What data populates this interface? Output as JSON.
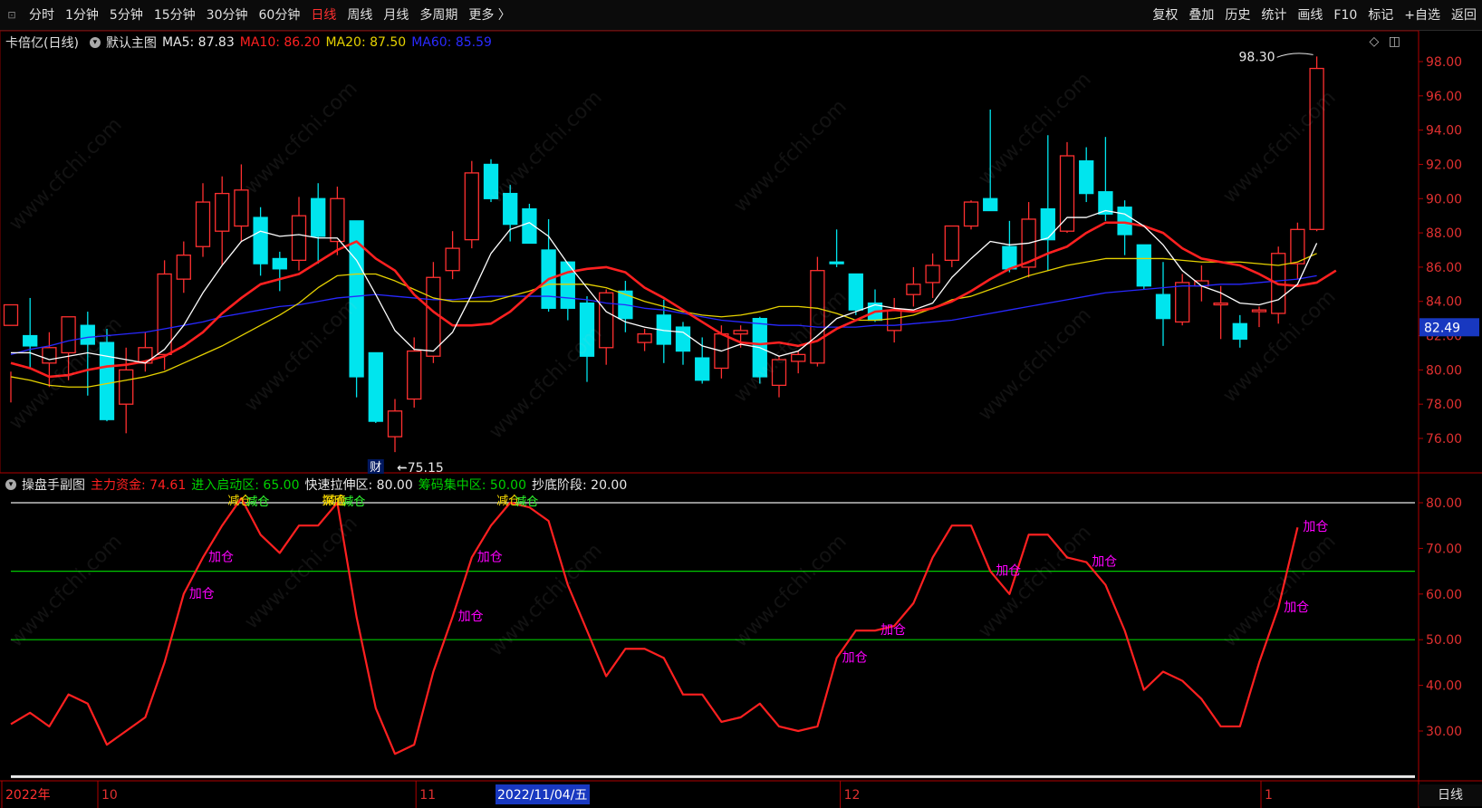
{
  "toolbar": {
    "left_items": [
      "分时",
      "1分钟",
      "5分钟",
      "15分钟",
      "30分钟",
      "60分钟",
      "日线",
      "周线",
      "月线",
      "多周期",
      "更多 〉"
    ],
    "active": "日线",
    "right_items": [
      "复权",
      "叠加",
      "历史",
      "统计",
      "画线",
      "F10",
      "标记",
      "+自选",
      "返回"
    ]
  },
  "main": {
    "stock": "卡倍亿(日线)",
    "indicator": "默认主图",
    "ma5": "MA5: 87.83",
    "ma10": "MA10: 86.20",
    "ma20": "MA20: 87.50",
    "ma60": "MA60: 85.59",
    "high_label": "98.30",
    "low_label": "75.15",
    "current_price": "82.49",
    "cai_label": "财",
    "y_ticks": [
      "98.00",
      "96.00",
      "94.00",
      "92.00",
      "90.00",
      "88.00",
      "86.00",
      "84.00",
      "82.00",
      "80.00",
      "78.00",
      "76.00"
    ]
  },
  "sub": {
    "name": "操盘手副图",
    "l1": "主力资金: 74.61",
    "l2": "进入启动区: 65.00",
    "l3": "快速拉伸区: 80.00",
    "l4": "筹码集中区: 50.00",
    "l5": "抄底阶段: 20.00",
    "y_ticks": [
      "80.00",
      "70.00",
      "60.00",
      "50.00",
      "40.00",
      "30.00"
    ],
    "signal": "加仓",
    "signal_top": "减仓",
    "signal_top2": "探底"
  },
  "xaxis": {
    "labels": [
      "2022年",
      "10",
      "11",
      "12",
      "1"
    ],
    "cursor_date": "2022/11/04/五",
    "period": "日线"
  },
  "watermark": "www.cfchi.com",
  "colors": {
    "up": "#ff3030",
    "down": "#00e5ee",
    "ma5": "#ffffff",
    "ma10": "#ff2020",
    "ma20": "#e6d200",
    "ma60": "#2828ff",
    "green": "#00c800",
    "magenta": "#ff00ff"
  },
  "chart_data": {
    "type": "candlestick",
    "ylim": [
      74.5,
      99.0
    ],
    "candles": [
      [
        82.6,
        83.8,
        79.9,
        78.1
      ],
      [
        82.0,
        81.4,
        84.2,
        80.1
      ],
      [
        80.4,
        81.3,
        82.2,
        79.0
      ],
      [
        81.0,
        83.1,
        83.1,
        79.4
      ],
      [
        82.6,
        81.5,
        83.4,
        78.5
      ],
      [
        81.6,
        77.1,
        82.4,
        77.0
      ],
      [
        78.0,
        80.0,
        81.3,
        76.3
      ],
      [
        80.4,
        81.3,
        82.2,
        79.9
      ],
      [
        80.9,
        85.6,
        86.4,
        80.0
      ],
      [
        85.3,
        86.7,
        87.5,
        84.5
      ],
      [
        87.2,
        89.8,
        90.9,
        86.6
      ],
      [
        88.1,
        90.3,
        91.3,
        86.1
      ],
      [
        88.4,
        90.5,
        92.0,
        87.5
      ],
      [
        88.9,
        86.2,
        89.5,
        85.5
      ],
      [
        86.5,
        85.9,
        86.9,
        84.6
      ],
      [
        86.4,
        89.0,
        90.1,
        85.8
      ],
      [
        90.0,
        87.8,
        90.9,
        86.2
      ],
      [
        87.5,
        90.0,
        90.7,
        86.7
      ],
      [
        88.7,
        79.6,
        88.7,
        78.4
      ],
      [
        81.0,
        77.0,
        81.0,
        76.9
      ],
      [
        76.1,
        77.6,
        78.3,
        75.2
      ],
      [
        78.3,
        81.1,
        81.9,
        77.8
      ],
      [
        80.8,
        85.4,
        86.3,
        80.4
      ],
      [
        85.8,
        87.1,
        88.1,
        85.3
      ],
      [
        87.6,
        91.5,
        92.2,
        87.1
      ],
      [
        92.0,
        90.0,
        92.3,
        89.8
      ],
      [
        90.3,
        88.5,
        90.8,
        87.5
      ],
      [
        89.4,
        87.4,
        89.7,
        87.4
      ],
      [
        87.0,
        83.6,
        88.8,
        83.4
      ],
      [
        86.3,
        83.6,
        86.3,
        82.9
      ],
      [
        83.9,
        80.8,
        84.3,
        79.3
      ],
      [
        81.3,
        84.5,
        84.7,
        80.3
      ],
      [
        84.6,
        83.0,
        85.2,
        82.2
      ],
      [
        81.6,
        82.1,
        82.4,
        81.1
      ],
      [
        83.2,
        81.5,
        84.1,
        80.4
      ],
      [
        82.5,
        81.1,
        82.8,
        80.3
      ],
      [
        80.7,
        79.4,
        81.9,
        79.2
      ],
      [
        80.1,
        82.1,
        82.6,
        79.5
      ],
      [
        82.1,
        82.3,
        82.6,
        81.3
      ],
      [
        83.0,
        79.6,
        83.1,
        79.2
      ],
      [
        79.1,
        80.6,
        80.8,
        78.4
      ],
      [
        80.5,
        80.9,
        81.1,
        79.8
      ],
      [
        80.4,
        85.8,
        86.6,
        80.2
      ],
      [
        86.3,
        86.2,
        88.2,
        86.0
      ],
      [
        85.6,
        83.5,
        85.4,
        83.2
      ],
      [
        83.9,
        82.9,
        84.7,
        82.8
      ],
      [
        82.3,
        83.5,
        84.2,
        81.6
      ],
      [
        84.4,
        85.0,
        86.0,
        83.7
      ],
      [
        85.1,
        86.1,
        86.8,
        84.2
      ],
      [
        86.4,
        88.4,
        88.4,
        86.0
      ],
      [
        88.4,
        89.8,
        89.9,
        88.2
      ],
      [
        90.0,
        89.3,
        95.2,
        89.3
      ],
      [
        87.2,
        85.9,
        88.7,
        85.7
      ],
      [
        86.0,
        88.8,
        89.8,
        85.4
      ],
      [
        89.4,
        87.6,
        93.7,
        85.8
      ],
      [
        88.1,
        92.5,
        93.3,
        88.0
      ],
      [
        92.2,
        90.3,
        93.0,
        89.8
      ],
      [
        90.4,
        89.1,
        93.6,
        88.7
      ],
      [
        89.5,
        87.9,
        89.9,
        86.7
      ],
      [
        87.3,
        84.9,
        87.3,
        84.7
      ],
      [
        84.4,
        83.0,
        86.3,
        81.4
      ],
      [
        82.8,
        85.1,
        85.6,
        82.6
      ],
      [
        84.9,
        85.2,
        86.1,
        84.0
      ],
      [
        83.8,
        83.9,
        84.9,
        81.8
      ],
      [
        82.7,
        81.8,
        83.2,
        81.3
      ],
      [
        83.4,
        83.5,
        83.7,
        82.5
      ],
      [
        83.3,
        86.8,
        87.2,
        82.7
      ],
      [
        86.2,
        88.2,
        88.6,
        85.3
      ],
      [
        88.2,
        97.6,
        98.3,
        88.1
      ]
    ],
    "ma5": [
      81.0,
      81.0,
      80.6,
      80.8,
      81.0,
      80.8,
      80.6,
      80.4,
      81.2,
      82.6,
      84.5,
      86.1,
      87.5,
      88.1,
      87.8,
      87.9,
      87.7,
      87.7,
      86.4,
      84.4,
      82.3,
      81.2,
      81.1,
      82.2,
      84.4,
      86.8,
      88.2,
      88.6,
      87.8,
      86.2,
      84.8,
      83.4,
      82.8,
      82.5,
      82.3,
      82.2,
      81.4,
      81.1,
      81.5,
      81.3,
      80.8,
      81.1,
      82.0,
      83.0,
      83.4,
      83.8,
      83.6,
      83.5,
      83.9,
      85.4,
      86.5,
      87.5,
      87.3,
      87.4,
      87.7,
      88.9,
      88.9,
      89.3,
      89.1,
      88.4,
      87.3,
      85.8,
      84.9,
      84.5,
      83.9,
      83.8,
      84.1,
      85.0,
      87.4
    ],
    "ma10": [
      80.4,
      80.1,
      79.6,
      79.7,
      80.0,
      80.2,
      80.3,
      80.5,
      80.8,
      81.4,
      82.2,
      83.3,
      84.2,
      85.0,
      85.3,
      85.6,
      86.3,
      87.0,
      87.5,
      86.5,
      85.8,
      84.4,
      83.4,
      82.6,
      82.6,
      82.7,
      83.4,
      84.4,
      85.3,
      85.7,
      85.9,
      86.0,
      85.7,
      84.8,
      84.2,
      83.5,
      82.8,
      82.1,
      81.6,
      81.5,
      81.6,
      81.4,
      81.7,
      82.4,
      82.9,
      83.4,
      83.5,
      83.4,
      83.6,
      84.0,
      84.6,
      85.3,
      85.9,
      86.3,
      86.8,
      87.2,
      88.0,
      88.6,
      88.6,
      88.4,
      88.0,
      87.1,
      86.5,
      86.3,
      86.1,
      85.6,
      85.0,
      84.9,
      85.1,
      85.8
    ],
    "ma20": [
      79.6,
      79.4,
      79.1,
      79.0,
      79.0,
      79.2,
      79.4,
      79.6,
      79.9,
      80.4,
      80.9,
      81.4,
      82.0,
      82.6,
      83.2,
      83.9,
      84.8,
      85.5,
      85.6,
      85.6,
      85.2,
      84.7,
      84.2,
      84.0,
      84.0,
      84.0,
      84.3,
      84.6,
      85.0,
      85.0,
      85.0,
      84.8,
      84.4,
      84.0,
      83.7,
      83.4,
      83.2,
      83.1,
      83.2,
      83.4,
      83.7,
      83.7,
      83.6,
      83.3,
      82.9,
      82.9,
      83.0,
      83.2,
      83.6,
      84.1,
      84.3,
      84.7,
      85.1,
      85.5,
      85.8,
      86.1,
      86.3,
      86.5,
      86.5,
      86.5,
      86.5,
      86.4,
      86.3,
      86.3,
      86.3,
      86.2,
      86.1,
      86.3,
      86.8
    ],
    "ma60": [
      80.9,
      81.2,
      81.4,
      81.7,
      81.9,
      82.0,
      82.1,
      82.2,
      82.4,
      82.6,
      82.8,
      83.1,
      83.3,
      83.5,
      83.7,
      83.8,
      84.0,
      84.2,
      84.3,
      84.4,
      84.3,
      84.2,
      84.1,
      84.1,
      84.2,
      84.3,
      84.3,
      84.3,
      84.3,
      84.2,
      84.1,
      83.9,
      83.8,
      83.6,
      83.5,
      83.3,
      83.1,
      82.9,
      82.8,
      82.7,
      82.6,
      82.6,
      82.5,
      82.5,
      82.5,
      82.6,
      82.6,
      82.7,
      82.8,
      82.9,
      83.1,
      83.3,
      83.5,
      83.7,
      83.9,
      84.1,
      84.3,
      84.5,
      84.6,
      84.7,
      84.8,
      84.9,
      84.9,
      85.0,
      85.0,
      85.1,
      85.2,
      85.3,
      85.5
    ],
    "main_fund": [
      31.5,
      34,
      31,
      38,
      36,
      27,
      30,
      33,
      45,
      60,
      68,
      75,
      81,
      73,
      69,
      75,
      75,
      80,
      55,
      35,
      25,
      27,
      43,
      55,
      68,
      75,
      80,
      79,
      76,
      62,
      52,
      42,
      48,
      48,
      46,
      38,
      38,
      32,
      33,
      36,
      31,
      30,
      31,
      46,
      52,
      52,
      53,
      58,
      68,
      75,
      75,
      65,
      60,
      73,
      73,
      68,
      67,
      62,
      52,
      39,
      43,
      41,
      37,
      31,
      31,
      45,
      57,
      74.6
    ]
  }
}
